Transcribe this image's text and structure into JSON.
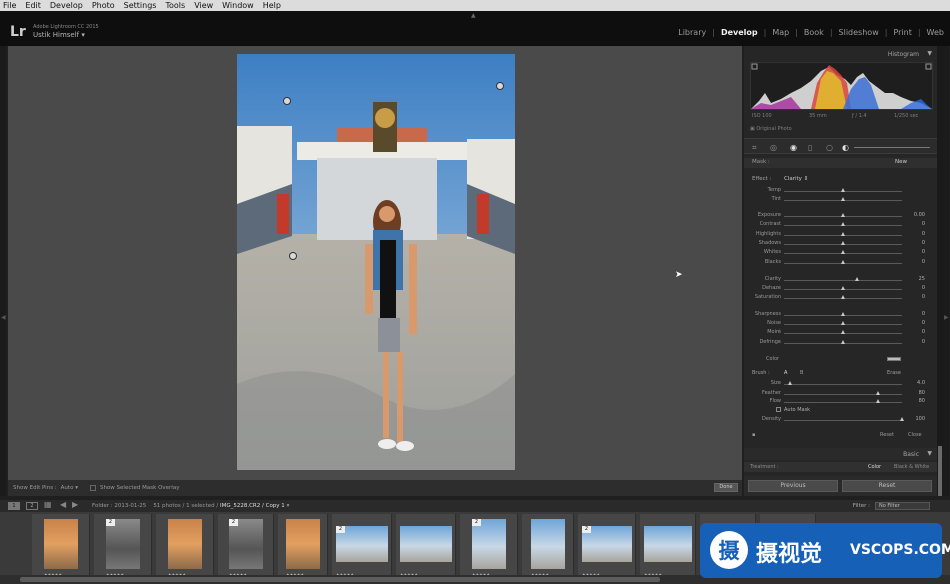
{
  "menu": [
    "File",
    "Edit",
    "Develop",
    "Photo",
    "Settings",
    "Tools",
    "View",
    "Window",
    "Help"
  ],
  "identity": {
    "logo": "Lr",
    "app_name": "Adobe Lightroom CC 2015",
    "user": "Ustik Himself"
  },
  "modules": [
    "Library",
    "Develop",
    "Map",
    "Book",
    "Slideshow",
    "Print",
    "Web"
  ],
  "active_module": "Develop",
  "right_panel": {
    "histogram_title": "Histogram",
    "meta": {
      "iso": "ISO 100",
      "focal": "35 mm",
      "aperture": "ƒ / 1.4",
      "shutter": "1/250 sec"
    },
    "original_photo": "Original Photo",
    "mask_label": "Mask :",
    "mask_new": "New",
    "effect_label": "Effect :",
    "effect_value": "Clarity",
    "sliders": [
      {
        "label": "Temp",
        "pos": 0.5,
        "value": ""
      },
      {
        "label": "Tint",
        "pos": 0.5,
        "value": ""
      },
      {
        "label": "Exposure",
        "pos": 0.5,
        "value": "0.00"
      },
      {
        "label": "Contrast",
        "pos": 0.5,
        "value": "0"
      },
      {
        "label": "Highlights",
        "pos": 0.5,
        "value": "0"
      },
      {
        "label": "Shadows",
        "pos": 0.5,
        "value": "0"
      },
      {
        "label": "Whites",
        "pos": 0.5,
        "value": "0"
      },
      {
        "label": "Blacks",
        "pos": 0.5,
        "value": "0"
      },
      {
        "label": "Clarity",
        "pos": 0.62,
        "value": "25"
      },
      {
        "label": "Dehaze",
        "pos": 0.5,
        "value": "0"
      },
      {
        "label": "Saturation",
        "pos": 0.5,
        "value": "0"
      },
      {
        "label": "Sharpness",
        "pos": 0.5,
        "value": "0"
      },
      {
        "label": "Noise",
        "pos": 0.5,
        "value": "0"
      },
      {
        "label": "Moiré",
        "pos": 0.5,
        "value": "0"
      },
      {
        "label": "Defringe",
        "pos": 0.5,
        "value": "0"
      }
    ],
    "color_label": "Color",
    "brush_label": "Brush :",
    "brush_a": "A",
    "brush_b": "B",
    "brush_erase": "Erase",
    "brush_sliders": [
      {
        "label": "Size",
        "pos": 0.05,
        "value": "4.0"
      },
      {
        "label": "Feather",
        "pos": 0.8,
        "value": "80"
      },
      {
        "label": "Flow",
        "pos": 0.8,
        "value": "80"
      }
    ],
    "auto_mask": "Auto Mask",
    "density": {
      "label": "Density",
      "pos": 1.0,
      "value": "100"
    },
    "reset": "Reset",
    "close": "Close",
    "basic_title": "Basic",
    "treatment_label": "Treatment :",
    "treatment_color": "Color",
    "treatment_bw": "Black & White",
    "previous_btn": "Previous",
    "reset_btn": "Reset"
  },
  "toolbar": {
    "show_edit_pins": "Show Edit Pins :",
    "auto": "Auto",
    "show_overlay": "Show Selected Mask Overlay",
    "done": "Done"
  },
  "filmstrip_header": {
    "view1": "1",
    "view2": "2",
    "folder": "Folder : 2013-01-25",
    "count": "51 photos / 1 selected /",
    "file": "IMG_5228.CR2 / Copy 1",
    "filter_label": "Filter :",
    "filter_value": "No Filter"
  },
  "filmstrip": [
    {
      "badge": "",
      "stars": "★★★★★"
    },
    {
      "badge": "2",
      "stars": "★★★★★"
    },
    {
      "badge": "",
      "stars": "★★★★★"
    },
    {
      "badge": "2",
      "stars": "★★★★★"
    },
    {
      "badge": "",
      "stars": "★★★★★"
    },
    {
      "badge": "2",
      "stars": "★★★★★"
    },
    {
      "badge": "",
      "stars": "★★★★★"
    },
    {
      "badge": "2",
      "stars": "★★★★★"
    },
    {
      "badge": "",
      "stars": "★★★★★"
    },
    {
      "badge": "2",
      "stars": "★★★★★"
    },
    {
      "badge": "",
      "stars": "★★★★★"
    },
    {
      "badge": "",
      "stars": "★★★★★"
    },
    {
      "badge": "",
      "stars": "★★★★★"
    }
  ],
  "watermark": {
    "logo_char": "摄",
    "cn": "摄视觉",
    "en": "VSCOPS.COM"
  }
}
